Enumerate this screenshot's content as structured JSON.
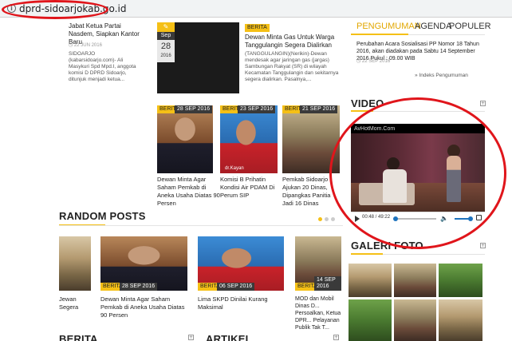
{
  "browser": {
    "info_icon": "i",
    "url": "dprd-sidoarjokab.go.id"
  },
  "top_left": {
    "title": "Jabat Ketua Partai Nasdem, Siapkan Kantor Baru",
    "date": "22 JUN 2016",
    "text": "SIDOARJO (kabarsidoarjo.com)- Ali Masykuri Spd Mpd.I, anggota komisi D DPRD Sidoarjo, ditunjuk menjadi ketua..."
  },
  "featured_date": {
    "month": "Sep",
    "day": "28",
    "year": "2016"
  },
  "featured_story": {
    "badge": "BERITA",
    "title": "Dewan Minta Gas Untuk Warga Tanggulangin Segera Dialirkan",
    "text": "(TANGGULANGIN)(Nerikin)-Dewan mendesak agar jaringan gas (jargas) Sambungan Rakyat (SR) di wilayah Kecamatan Tanggulangin dan sekitarnya segera dialirkan. Pasalnya,..."
  },
  "news_cards": [
    {
      "badge": "BERITA",
      "date": "28 SEP 2016",
      "title": "Dewan Minta Agar Saham Pemkab di Aneka Usaha Diatas 90 Persen"
    },
    {
      "badge": "BERITA",
      "date": "23 SEP 2016",
      "title": "Komisi B Prihatin Kondisi Air PDAM Di Perum SIP",
      "photo_caption": "dr.Kayan"
    },
    {
      "badge": "BERITA",
      "date": "21 SEP 2016",
      "title": "Pemkab Sidoarjo Ajukan 20 Dinas, Dipangkas Panitia Jadi 16 Dinas"
    }
  ],
  "random_posts": {
    "heading": "RANDOM POSTS",
    "items": [
      {
        "title": "Jewan Segera"
      },
      {
        "badge": "BERITA",
        "date": "28 SEP 2016",
        "title": "Dewan Minta Agar Saham Pemkab di Aneka Usaha Diatas 90 Persen"
      },
      {
        "badge": "BERITA",
        "date": "06 SEP 2016",
        "title": "Lima SKPD Dinilai Kurang Maksimal"
      },
      {
        "badge": "BERITA",
        "date": "14 SEP 2016",
        "title": "MOD dan Mobil Dinas D... Persoalkan, Ketua DPR... Pelayanan Publik Tak T..."
      }
    ]
  },
  "bottom_headings": {
    "berita": "BERITA",
    "artikel": "ARTIKEL"
  },
  "tabs": {
    "pengumuman": "PENGUMUMAN",
    "agenda": "AGENDA",
    "populer": "POPULER"
  },
  "announcement": {
    "title": "Perubahan Acara Sosialisasi PP Nomor 18 Tahun 2016, akan diadakan pada Sabtu 14 September 2016 Pukul : 09.00 WIB",
    "date": "22 SEP 2016",
    "index_link": "» Indeks Pengumuman"
  },
  "video": {
    "heading": "VIDEO",
    "watermark": "AvHotMom.Com",
    "time": "00:48 / 49:22",
    "progress": 0.016,
    "volume": 1.0
  },
  "gallery": {
    "heading": "GALERI FOTO"
  },
  "colors": {
    "accent": "#f5c016",
    "annotation": "#e0151b",
    "tab_active": "#e2a700"
  }
}
